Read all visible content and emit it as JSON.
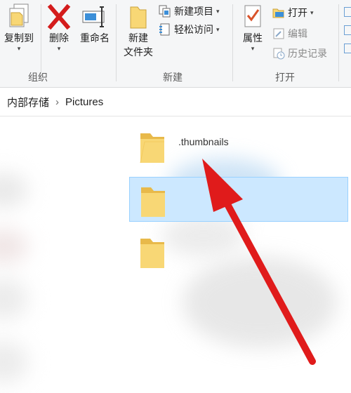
{
  "ribbon": {
    "groups": {
      "organize": "组织",
      "new": "新建",
      "open": "打开"
    },
    "buttons": {
      "copy_to": "复制到",
      "delete": "删除",
      "rename": "重命名",
      "new_folder_line1": "新建",
      "new_folder_line2": "文件夹",
      "properties": "属性"
    },
    "small": {
      "new_item": "新建项目",
      "easy_access": "轻松访问",
      "open": "打开",
      "edit": "编辑",
      "history": "历史记录"
    }
  },
  "address_bar": {
    "crumbs": [
      "内部存储",
      "Pictures"
    ],
    "separator": "›"
  },
  "files": [
    {
      "name": ".thumbnails",
      "selected": false
    },
    {
      "name": "",
      "selected": true
    },
    {
      "name": "",
      "selected": false
    }
  ],
  "colors": {
    "selection": "#cce8ff",
    "selection_border": "#99d1ff",
    "folder": "#f8d775",
    "arrow": "#e01b1b"
  },
  "icons": [
    "copy-to-icon",
    "delete-icon",
    "rename-icon",
    "new-folder-icon",
    "new-item-icon",
    "easy-access-icon",
    "properties-icon",
    "open-icon",
    "edit-icon",
    "history-icon",
    "folder-icon",
    "red-arrow-annotation"
  ]
}
